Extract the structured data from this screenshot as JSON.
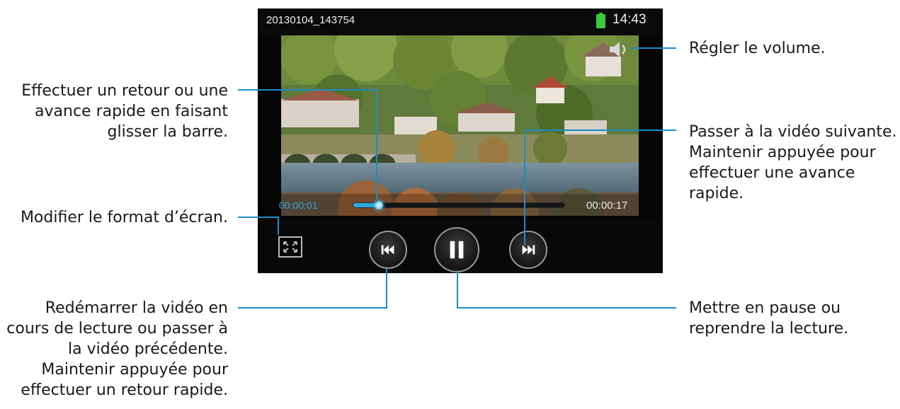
{
  "player": {
    "file_name": "20130104_143754",
    "clock": "14:43",
    "time_elapsed": "00:00:01",
    "time_total": "00:00:17",
    "progress_fraction": 0.12,
    "accent_color": "#2aa8e0",
    "battery_color": "#3cc83c"
  },
  "icons": {
    "battery": "battery-icon",
    "volume": "volume-icon",
    "aspect": "screen-format-icon",
    "previous": "skip-previous-icon",
    "pause": "pause-icon",
    "next": "skip-next-icon"
  },
  "callouts": {
    "volume": [
      "Régler le volume."
    ],
    "seek": [
      "Effectuer un retour ou une",
      "avance rapide en faisant",
      "glisser la barre."
    ],
    "next": [
      "Passer à la vidéo suivante.",
      "Maintenir appuyée pour",
      "effectuer une avance",
      "rapide."
    ],
    "aspect": [
      "Modifier le format d’écran."
    ],
    "previous": [
      "Redémarrer la vidéo en",
      "cours de lecture ou passer à",
      "la vidéo précédente.",
      "Maintenir appuyée pour",
      "effectuer un retour rapide."
    ],
    "pause": [
      "Mettre en pause ou",
      "reprendre la lecture."
    ]
  }
}
